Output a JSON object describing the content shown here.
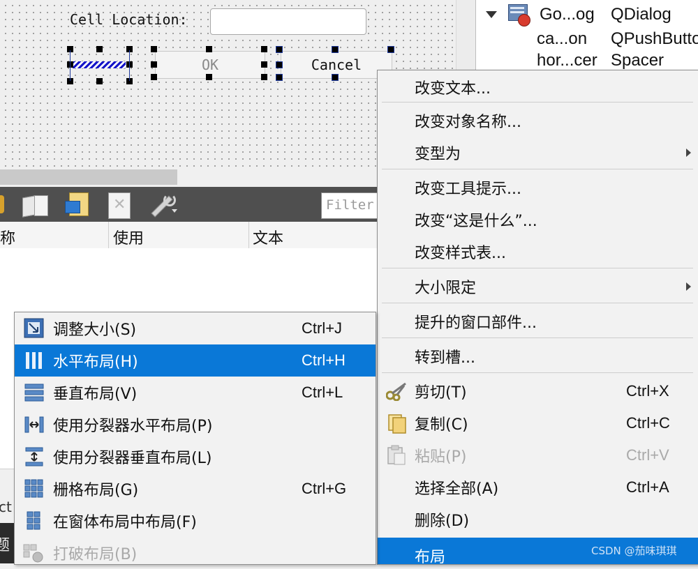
{
  "form": {
    "cell_location_label": "Cell Location:",
    "cell_location_value": "",
    "ok_label": "OK",
    "cancel_label": "Cancel"
  },
  "object_inspector": {
    "rows": [
      {
        "name": "Go...og",
        "class": "QDialog"
      },
      {
        "name": "ca...on",
        "class": "QPushButto"
      },
      {
        "name": "hor...cer",
        "class": "Spacer"
      }
    ]
  },
  "action_editor": {
    "filter_placeholder": "Filter",
    "columns": [
      "称",
      "使用",
      "文本"
    ]
  },
  "context_menu": {
    "items": [
      {
        "label": "改变文本..."
      },
      {
        "label": "改变对象名称..."
      },
      {
        "label": "变型为",
        "submenu": true
      },
      {
        "label": "改变工具提示..."
      },
      {
        "label": "改变“这是什么”..."
      },
      {
        "label": "改变样式表..."
      },
      {
        "label": "大小限定",
        "submenu": true
      },
      {
        "label": "提升的窗口部件..."
      },
      {
        "label": "转到槽..."
      },
      {
        "label": "剪切(T)",
        "shortcut": "Ctrl+X",
        "icon": "scissors-icon"
      },
      {
        "label": "复制(C)",
        "shortcut": "Ctrl+C",
        "icon": "copy-icon"
      },
      {
        "label": "粘贴(P)",
        "shortcut": "Ctrl+V",
        "icon": "paste-icon",
        "disabled": true
      },
      {
        "label": "选择全部(A)",
        "shortcut": "Ctrl+A"
      },
      {
        "label": "删除(D)"
      },
      {
        "label": "布局",
        "highlighted": true
      }
    ]
  },
  "layout_submenu": {
    "items": [
      {
        "label": "调整大小(S)",
        "shortcut": "Ctrl+J",
        "icon": "adjust-size-icon"
      },
      {
        "label": "水平布局(H)",
        "shortcut": "Ctrl+H",
        "icon": "horizontal-layout-icon",
        "highlighted": true
      },
      {
        "label": "垂直布局(V)",
        "shortcut": "Ctrl+L",
        "icon": "vertical-layout-icon"
      },
      {
        "label": "使用分裂器水平布局(P)",
        "icon": "splitter-horizontal-icon"
      },
      {
        "label": "使用分裂器垂直布局(L)",
        "icon": "splitter-vertical-icon"
      },
      {
        "label": "栅格布局(G)",
        "shortcut": "Ctrl+G",
        "icon": "grid-layout-icon"
      },
      {
        "label": "在窗体布局中布局(F)",
        "icon": "form-layout-icon"
      },
      {
        "label": "打破布局(B)",
        "icon": "break-layout-icon",
        "disabled": true
      }
    ]
  },
  "lower_panel": {
    "tab_fragment": "ct",
    "title_fragment": "题"
  },
  "watermark": "CSDN @茄味琪琪"
}
